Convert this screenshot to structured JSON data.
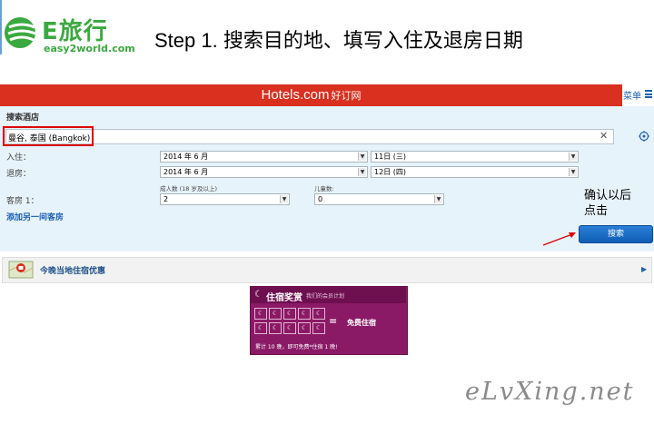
{
  "logo": {
    "title": "E旅行",
    "subtitle": "easy2world.com"
  },
  "step_title": "Step 1. 搜索目的地、填写入住及退房日期",
  "header": {
    "brand": "Hotels.com",
    "brand_cn": "好订网",
    "menu_label": "菜单"
  },
  "search": {
    "heading": "搜索酒店",
    "destination_value": "曼谷, 泰国 (Bangkok)",
    "clear_symbol": "✕",
    "checkin_label": "入住：",
    "checkin_month": "2014 年 6 月",
    "checkin_day": "11日 (三)",
    "checkout_label": "退房：",
    "checkout_month": "2014 年 6 月",
    "checkout_day": "12日 (四)",
    "adults_label": "成人数 (18 岁及以上)",
    "children_label": "儿童数:",
    "rooms_label": "客房 1：",
    "adults_value": "2",
    "children_value": "0",
    "add_room": "添加另一间客房",
    "search_button": "搜索"
  },
  "annotation": {
    "line1": "确认以后",
    "line2": "点击"
  },
  "deals": {
    "label": "今晚当地住宿优惠"
  },
  "rewards": {
    "title": "住宿奖赏",
    "subtitle": "我们的会员计划",
    "equals": "=",
    "free_night": "免费住宿",
    "footer": "累计 10 晚，即可免费*住宿 1 晚!"
  },
  "watermark": "eLvXing.net",
  "colors": {
    "header_red": "#d9301f",
    "panel_blue": "#e7f3fa",
    "link_blue": "#1b5fb0",
    "rewards_purple": "#8b1a66",
    "highlight_red": "#dd0000"
  }
}
